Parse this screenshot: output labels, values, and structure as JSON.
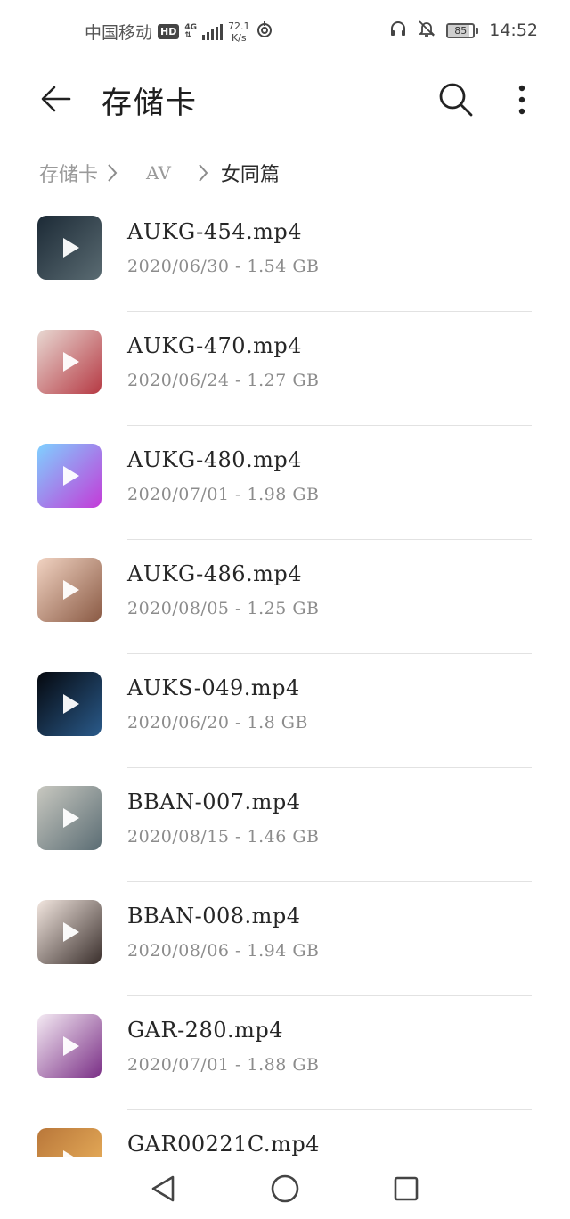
{
  "status_bar": {
    "carrier": "中国移动",
    "hd_label": "HD",
    "network_label": "4G",
    "speed_value": "72.1",
    "speed_unit": "K/s",
    "battery_level": 85,
    "battery_text": "85",
    "time": "14:52"
  },
  "app_bar": {
    "title": "存储卡",
    "icons": {
      "back": "arrow-left-icon",
      "search": "search-icon",
      "more": "more-vertical-icon"
    }
  },
  "breadcrumb": {
    "items": [
      "存储卡",
      "AV",
      "女同篇"
    ]
  },
  "files": [
    {
      "name": "AUKG-454.mp4",
      "meta": "2020/06/30 - 1.54 GB",
      "thumb_colors": [
        "#1c2a36",
        "#5a6b72"
      ]
    },
    {
      "name": "AUKG-470.mp4",
      "meta": "2020/06/24 - 1.27 GB",
      "thumb_colors": [
        "#e8d8d2",
        "#b63a44"
      ]
    },
    {
      "name": "AUKG-480.mp4",
      "meta": "2020/07/01 - 1.98 GB",
      "thumb_colors": [
        "#7fd0ff",
        "#c33bd8"
      ]
    },
    {
      "name": "AUKG-486.mp4",
      "meta": "2020/08/05 - 1.25 GB",
      "thumb_colors": [
        "#f1d3c2",
        "#8a5a44"
      ]
    },
    {
      "name": "AUKS-049.mp4",
      "meta": "2020/06/20 - 1.8 GB",
      "thumb_colors": [
        "#05080e",
        "#2a5a8a"
      ]
    },
    {
      "name": "BBAN-007.mp4",
      "meta": "2020/08/15 - 1.46 GB",
      "thumb_colors": [
        "#c8c8c0",
        "#5b6d74"
      ]
    },
    {
      "name": "BBAN-008.mp4",
      "meta": "2020/08/06 - 1.94 GB",
      "thumb_colors": [
        "#f2e6df",
        "#3a2f2c"
      ]
    },
    {
      "name": "GAR-280.mp4",
      "meta": "2020/07/01 - 1.88 GB",
      "thumb_colors": [
        "#f4eaf3",
        "#7a2f86"
      ]
    },
    {
      "name": "GAR00221C.mp4",
      "meta": "",
      "thumb_colors": [
        "#b9773a",
        "#f0b860"
      ]
    }
  ],
  "nav_bar": {
    "icons": {
      "back": "triangle-back-icon",
      "home": "circle-home-icon",
      "recents": "square-recents-icon"
    }
  }
}
